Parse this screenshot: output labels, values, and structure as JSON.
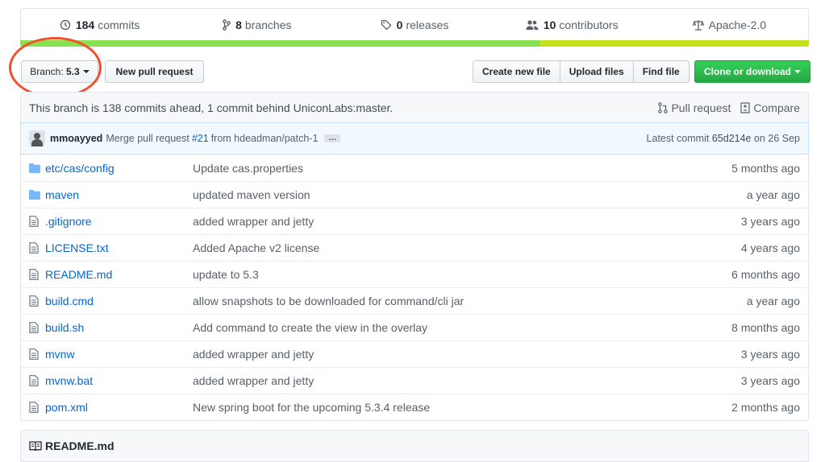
{
  "summary": {
    "commits": {
      "count": "184",
      "label": "commits"
    },
    "branches": {
      "count": "8",
      "label": "branches"
    },
    "releases": {
      "count": "0",
      "label": "releases"
    },
    "contributors": {
      "count": "10",
      "label": "contributors"
    },
    "license": "Apache-2.0"
  },
  "toolbar": {
    "branch_prefix": "Branch:",
    "branch_value": "5.3",
    "new_pr": "New pull request",
    "create_file": "Create new file",
    "upload_files": "Upload files",
    "find_file": "Find file",
    "clone": "Clone or download"
  },
  "info": {
    "text": "This branch is 138 commits ahead, 1 commit behind UniconLabs:master.",
    "pull_request": "Pull request",
    "compare": "Compare"
  },
  "commit": {
    "author": "mmoayyed",
    "message_pre": "Merge pull request",
    "pr_link": "#21",
    "message_post": "from hdeadman/patch-1",
    "ellipsis": "…",
    "latest_label": "Latest commit",
    "sha": "65d214e",
    "date": "on 26 Sep"
  },
  "files": [
    {
      "type": "dir",
      "name_prefix": "etc/cas/",
      "name": "config",
      "message": "Update cas.properties",
      "age": "5 months ago"
    },
    {
      "type": "dir",
      "name_prefix": "",
      "name": "maven",
      "message": "updated maven version",
      "age": "a year ago"
    },
    {
      "type": "file",
      "name_prefix": "",
      "name": ".gitignore",
      "message": "added wrapper and jetty",
      "age": "3 years ago"
    },
    {
      "type": "file",
      "name_prefix": "",
      "name": "LICENSE.txt",
      "message": "Added Apache v2 license",
      "age": "4 years ago"
    },
    {
      "type": "file",
      "name_prefix": "",
      "name": "README.md",
      "message": "update to 5.3",
      "age": "6 months ago"
    },
    {
      "type": "file",
      "name_prefix": "",
      "name": "build.cmd",
      "message": "allow snapshots to be downloaded for command/cli jar",
      "age": "a year ago"
    },
    {
      "type": "file",
      "name_prefix": "",
      "name": "build.sh",
      "message": "Add command to create the view in the overlay",
      "age": "8 months ago"
    },
    {
      "type": "file",
      "name_prefix": "",
      "name": "mvnw",
      "message": "added wrapper and jetty",
      "age": "3 years ago"
    },
    {
      "type": "file",
      "name_prefix": "",
      "name": "mvnw.bat",
      "message": "added wrapper and jetty",
      "age": "3 years ago"
    },
    {
      "type": "file",
      "name_prefix": "",
      "name": "pom.xml",
      "message": "New spring boot for the upcoming 5.3.4 release",
      "age": "2 months ago"
    }
  ],
  "readme": {
    "title": "README.md"
  },
  "colors": {
    "accent": "#0366d6",
    "green": "#28a745",
    "highlight": "#f0502a",
    "lang1": "#89e051",
    "lang2": "#c6e01c"
  }
}
